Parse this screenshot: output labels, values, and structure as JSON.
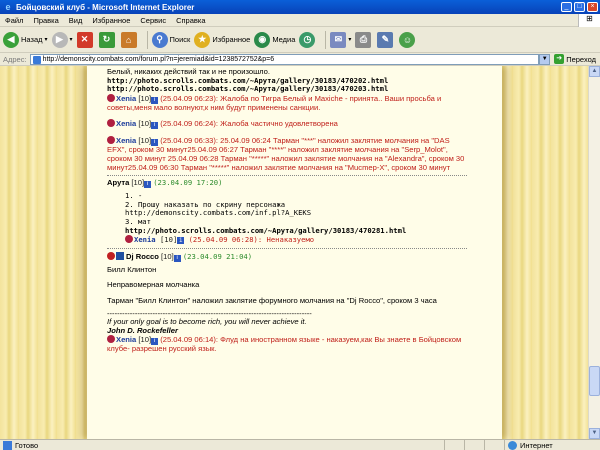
{
  "window": {
    "title": "Бойцовский клуб - Microsoft Internet Explorer",
    "controls": {
      "minimize": "_",
      "maximize": "□",
      "close": "×"
    }
  },
  "menu": [
    "Файл",
    "Правка",
    "Вид",
    "Избранное",
    "Сервис",
    "Справка"
  ],
  "toolbar": {
    "back": "Назад",
    "search": "Поиск",
    "favorites": "Избранное",
    "media": "Медиа"
  },
  "address": {
    "label": "Адрес:",
    "url": "http://demonscity.combats.com/forum.pl?n=jeremiad&id=1238572752&p=6",
    "go": "Переход"
  },
  "forum": {
    "post1": {
      "line_top": "Белый, никаких действий так и не произошло.",
      "url1": "http://photo.scrolls.combats.com/~Apyтa/gallery/30183/470202.html",
      "url2": "http://photo.scrolls.combats.com/~Apyтa/gallery/30183/470203.html",
      "reply1": {
        "name": "Xenia",
        "level": "[10]",
        "time": "(25.04.09 06:23):",
        "text": "Жалоба по Тигра Белый и Maxiche - принята.. Ваши просьба и советы,меня мало волнуют,к ним будут применены   санкции."
      },
      "reply2": {
        "name": "Xenia",
        "level": "[10]",
        "time": "(25.04.09 06:24):",
        "text": "Жалоба частично удовлетворена"
      },
      "reply3": {
        "name": "Xenia",
        "level": "[10]",
        "time": "(25.04.09 06:33):",
        "text": "25.04.09 06:24   Тарман \"***\" наложил заклятие молчания на \"DAS EFX\", сроком 30 минут25.04.09 06:27   Тарман \"****\" наложил заклятие молчания на \"Serp_Molot\", сроком 30 минут 25.04.09 06:28   Тарман \"*****\" наложил заклятие молчания на \"Alexandra\", сроком 30 минут25.04.09 06:30   Тарман \"*****\" наложил заклятие молчания на \"Mucmep-X\", сроком 30 минут"
      }
    },
    "post2": {
      "author": "Apyтa",
      "level": "[10]",
      "timestamp": "(23.04.09 17:20)",
      "line1": "1. -",
      "line2": "2. Прошу наказать по скрину персонажа",
      "link": "http://demonscity.combats.com/inf.pl?A_KEKS",
      "line3": "3. мат",
      "url": "http://photo.scrolls.combats.com/~Apyтa/gallery/30183/470281.html",
      "reply": {
        "name": "Xenia",
        "level": "[10]",
        "time": "(25.04.09 06:28):",
        "text": "Ненаказуемо"
      }
    },
    "post3": {
      "author": "Dj Rocco",
      "level": "[10]",
      "timestamp": "(23.04.09 21:04)",
      "line1": "Билл Клинтон",
      "line2": "Неправомерная молчанка",
      "line3": "Тарман \"Билл Клинтон\" наложил заклятие форумного молчания на \"Dj Rocco\", сроком 3 часа",
      "separator": "---------------------------------------------------------------------------------",
      "quote": "If your only goal is to become rich, you will never achieve it.",
      "quote_author": "John D. Rockefeller",
      "reply": {
        "name": "Xenia",
        "level": "[10]",
        "time": "(25.04.09 06:14):",
        "text": "Флуд на иностранном языке - наказуем,как Вы знаете в Бойцовском клубе- разрешен русский язык."
      }
    }
  },
  "status": {
    "text": "Готово",
    "zone": "Интернет"
  }
}
